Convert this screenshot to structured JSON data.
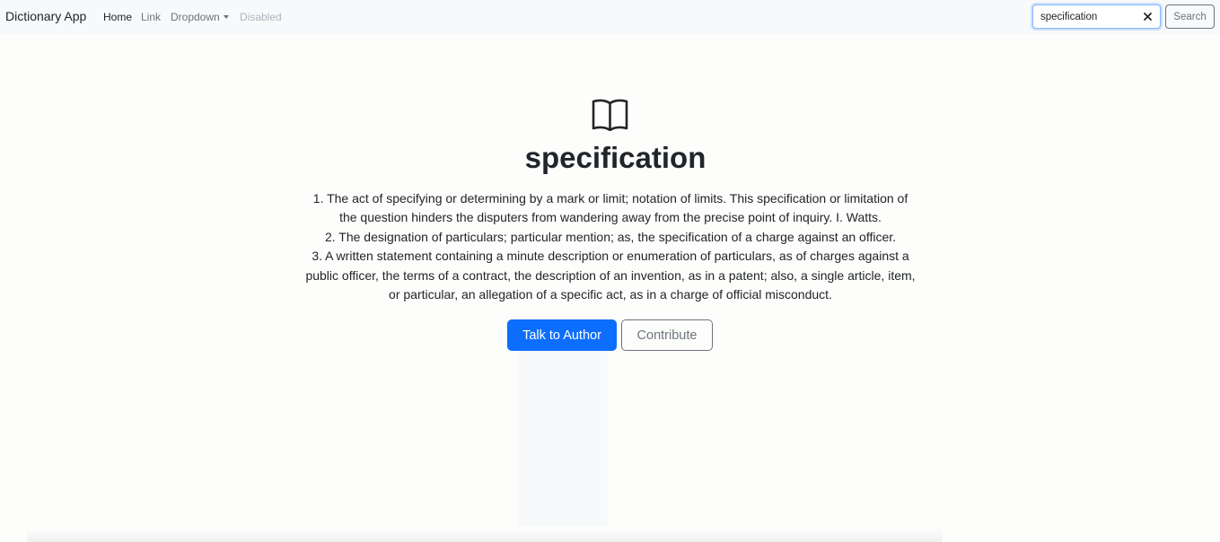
{
  "navbar": {
    "brand": "Dictionary App",
    "links": [
      {
        "label": "Home",
        "state": "active"
      },
      {
        "label": "Link",
        "state": "normal"
      },
      {
        "label": "Dropdown",
        "state": "normal"
      },
      {
        "label": "Disabled",
        "state": "disabled"
      }
    ],
    "search": {
      "value": "specification",
      "button_label": "Search",
      "clear_icon": "close-icon"
    }
  },
  "main": {
    "icon": "book-icon",
    "word": "specification",
    "definitions": [
      "1. The act of specifying or determining by a mark or limit; notation of limits. This specification or limitation of the question hinders the disputers from wandering away from the precise point of inquiry. I. Watts.",
      "2. The designation of particulars; particular mention; as, the specification of a charge against an officer.",
      "3. A written statement containing a minute description or enumeration of particulars, as of charges against a public officer, the terms of a contract, the description of an invention, as in a patent; also, a single article, item, or particular, an allegation of a specific act, as in a charge of official misconduct."
    ],
    "buttons": {
      "talk_to_author": "Talk to Author",
      "contribute": "Contribute"
    }
  },
  "colors": {
    "primary": "#0d6efd",
    "secondary": "#6c757d",
    "navbar_bg": "#f8f9fa"
  }
}
